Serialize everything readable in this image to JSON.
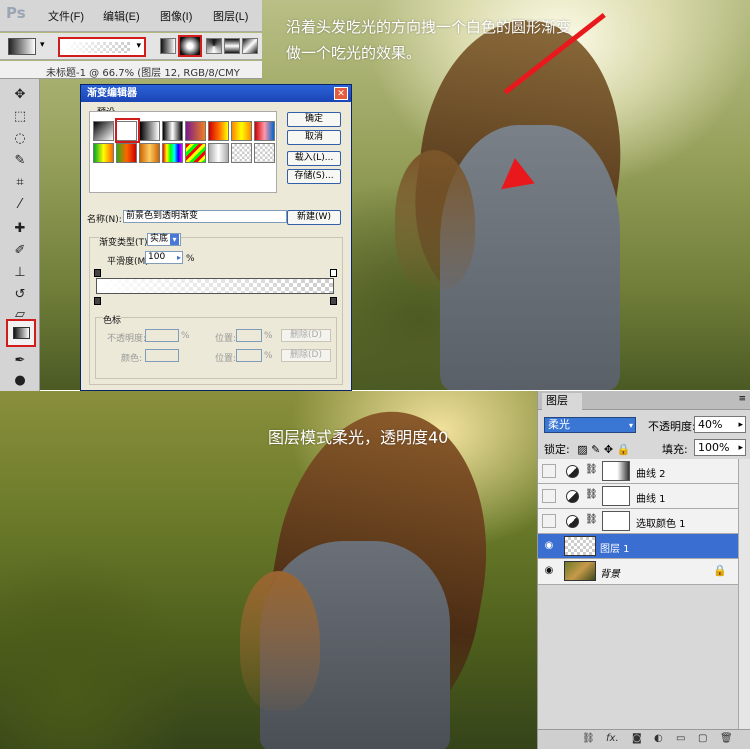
{
  "app": {
    "logo": "Ps",
    "menu": [
      "文件(F)",
      "编辑(E)",
      "图像(I)",
      "图层(L)"
    ],
    "doc_title": "未标题-1 @ 66.7% (图层 12, RGB/8/CMY"
  },
  "tools": [
    "move-tool",
    "marquee-tool",
    "lasso-tool",
    "quick-select-tool",
    "crop-tool",
    "eyedropper-tool",
    "healing-tool",
    "brush-tool",
    "stamp-tool",
    "history-brush-tool",
    "eraser-tool",
    "gradient-tool",
    "pen-tool",
    "zoom-tool"
  ],
  "annotations": {
    "top_line1": "沿着头发吃光的方向拽一个白色的圆形渐变",
    "top_line2": "做一个吃光的效果。",
    "bottom": "图层模式柔光，透明度40"
  },
  "gradient_editor": {
    "title": "渐变编辑器",
    "preset_label": "预设",
    "buttons": [
      "确定",
      "取消",
      "载入(L)...",
      "存储(S)..."
    ],
    "name_label": "名称(N):",
    "name_value": "前景色到透明渐变",
    "new_button": "新建(W)",
    "type_label": "渐变类型(T):",
    "type_value": "实底",
    "smooth_label": "平滑度(M):",
    "smooth_value": "100",
    "smooth_unit": "%",
    "color_stops_label": "色标",
    "opacity_label": "不透明度:",
    "opacity_unit": "%",
    "location_label": "位置:",
    "location_unit": "%",
    "delete_label": "删除(D)",
    "color_label": "颜色:"
  },
  "layers": {
    "tab": "图层",
    "blend_mode": "柔光",
    "opacity_label": "不透明度:",
    "opacity_value": "40%",
    "lock_label": "锁定:",
    "fill_label": "填充:",
    "fill_value": "100%",
    "rows": [
      {
        "name": "曲线 2",
        "visible": false,
        "type": "adjustment"
      },
      {
        "name": "曲线 1",
        "visible": false,
        "type": "adjustment"
      },
      {
        "name": "选取颜色 1",
        "visible": false,
        "type": "adjustment"
      },
      {
        "name": "图层 1",
        "visible": true,
        "type": "pixel",
        "selected": true
      },
      {
        "name": "背景",
        "visible": true,
        "type": "background",
        "locked": true
      }
    ]
  },
  "colors": {
    "accent_red": "#d21c1c",
    "selection_blue": "#3a6ed0"
  }
}
